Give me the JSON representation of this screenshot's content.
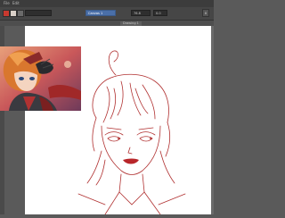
{
  "app": {
    "menu": [
      "File",
      "Edit"
    ],
    "toolbar": {
      "field_left": "",
      "field_blue": "Canvas 1",
      "zoom_value": "76.8",
      "rotate_value": "0.0",
      "mode_button": "X"
    },
    "document_tab": "Drawing 1"
  },
  "colors": {
    "ui_dark": "#3c3c3c",
    "canvas": "#ffffff",
    "sketch_line": "#b03030",
    "accent_blue": "#4a6fa8"
  },
  "reference_image": {
    "label": "reference illustration"
  },
  "sketch": {
    "label": "red line sketch of a character portrait"
  }
}
